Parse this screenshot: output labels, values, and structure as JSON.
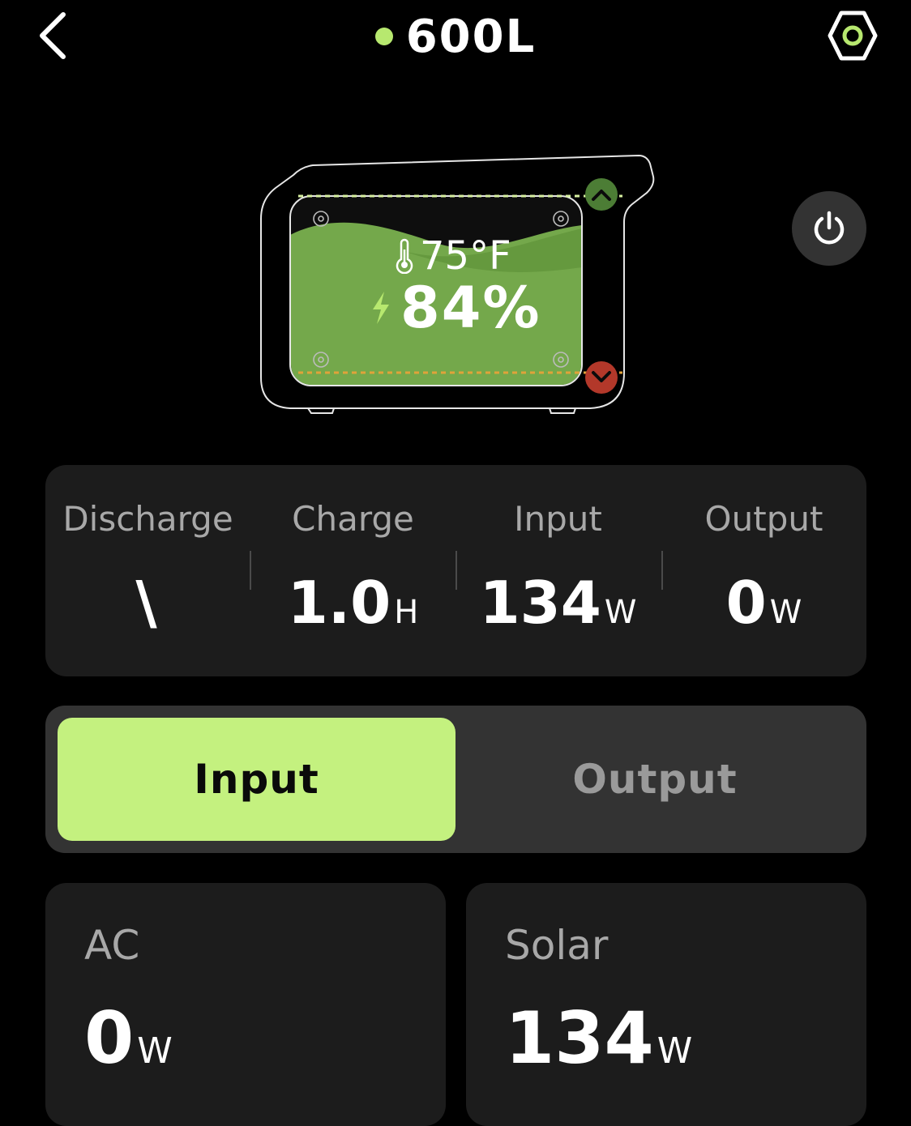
{
  "header": {
    "device_name": "600L",
    "status_color": "#b7e86f",
    "back_icon": "chevron-left-icon",
    "settings_icon": "hex-settings-icon"
  },
  "battery": {
    "temperature": "75°F",
    "percent": "84%",
    "charge_level": 0.84,
    "charging": true,
    "upper_limit_color": "#4c7d35",
    "lower_limit_color": "#b3382a",
    "fill_color": "#74a84b"
  },
  "power_icon": "power-icon",
  "stats": [
    {
      "label": "Discharge",
      "value": "\\",
      "unit": ""
    },
    {
      "label": "Charge",
      "value": "1.0",
      "unit": "H"
    },
    {
      "label": "Input",
      "value": "134",
      "unit": "W"
    },
    {
      "label": "Output",
      "value": "0",
      "unit": "W"
    }
  ],
  "toggle": {
    "input_label": "Input",
    "output_label": "Output",
    "active": "input",
    "active_color": "#c4f17f"
  },
  "sources": [
    {
      "label": "AC",
      "value": "0",
      "unit": "W"
    },
    {
      "label": "Solar",
      "value": "134",
      "unit": "W"
    }
  ]
}
